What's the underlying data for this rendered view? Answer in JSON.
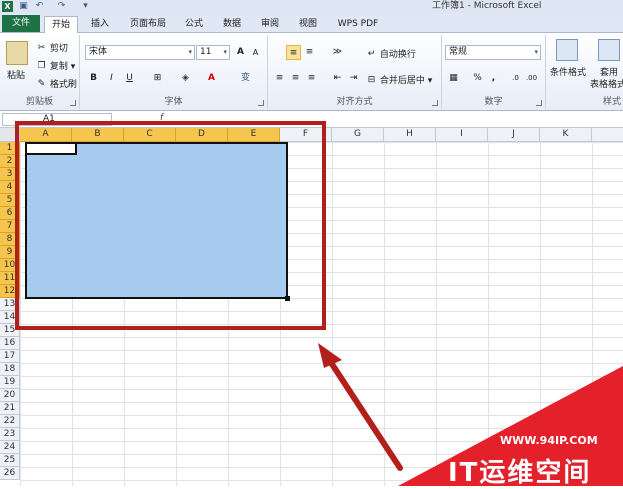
{
  "window": {
    "title": "工作簿1 - Microsoft Excel",
    "app_icon": "X"
  },
  "qat": [
    "save-icon",
    "undo-icon",
    "redo-icon",
    "customize-icon"
  ],
  "tabs": [
    "文件",
    "开始",
    "插入",
    "页面布局",
    "公式",
    "数据",
    "审阅",
    "视图",
    "WPS PDF"
  ],
  "clipboard": {
    "paste": "粘贴",
    "cut": "剪切",
    "copy": "复制",
    "format_painter": "格式刷",
    "label": "剪贴板"
  },
  "font": {
    "name": "宋体",
    "size": "11",
    "bold": "B",
    "italic": "I",
    "underline": "U",
    "font_color": "A",
    "phonetic": "变",
    "label": "字体",
    "grow": "A",
    "shrink": "A"
  },
  "alignment": {
    "wrap": "自动换行",
    "merge": "合并后居中",
    "label": "对齐方式"
  },
  "number": {
    "format": "常规",
    "percent": "%",
    "comma": ",",
    "label": "数字"
  },
  "styles": {
    "conditional": "条件格式",
    "table_a": "套用",
    "table_b": "表格格式",
    "label": "样式"
  },
  "formula_bar": {
    "name_box": "A1",
    "fx": "f"
  },
  "columns": [
    "A",
    "B",
    "C",
    "D",
    "E",
    "F",
    "G",
    "H",
    "I",
    "J",
    "K"
  ],
  "selected_columns": [
    "A",
    "B",
    "C",
    "D",
    "E"
  ],
  "rows": [
    "1",
    "2",
    "3",
    "4",
    "5",
    "6",
    "7",
    "8",
    "9",
    "10",
    "11",
    "12",
    "13",
    "14",
    "15",
    "16",
    "17",
    "18",
    "19",
    "20",
    "21",
    "22",
    "23",
    "24",
    "25",
    "26"
  ],
  "selected_rows_count": 12,
  "watermark": {
    "url": "WWW.94IP.COM",
    "brand": "IT运维空间"
  },
  "colors": {
    "excel_green": "#1e7145",
    "selection": "#a7cbee",
    "header_highlight": "#f5c54e",
    "annotation_red": "#b3201c"
  }
}
